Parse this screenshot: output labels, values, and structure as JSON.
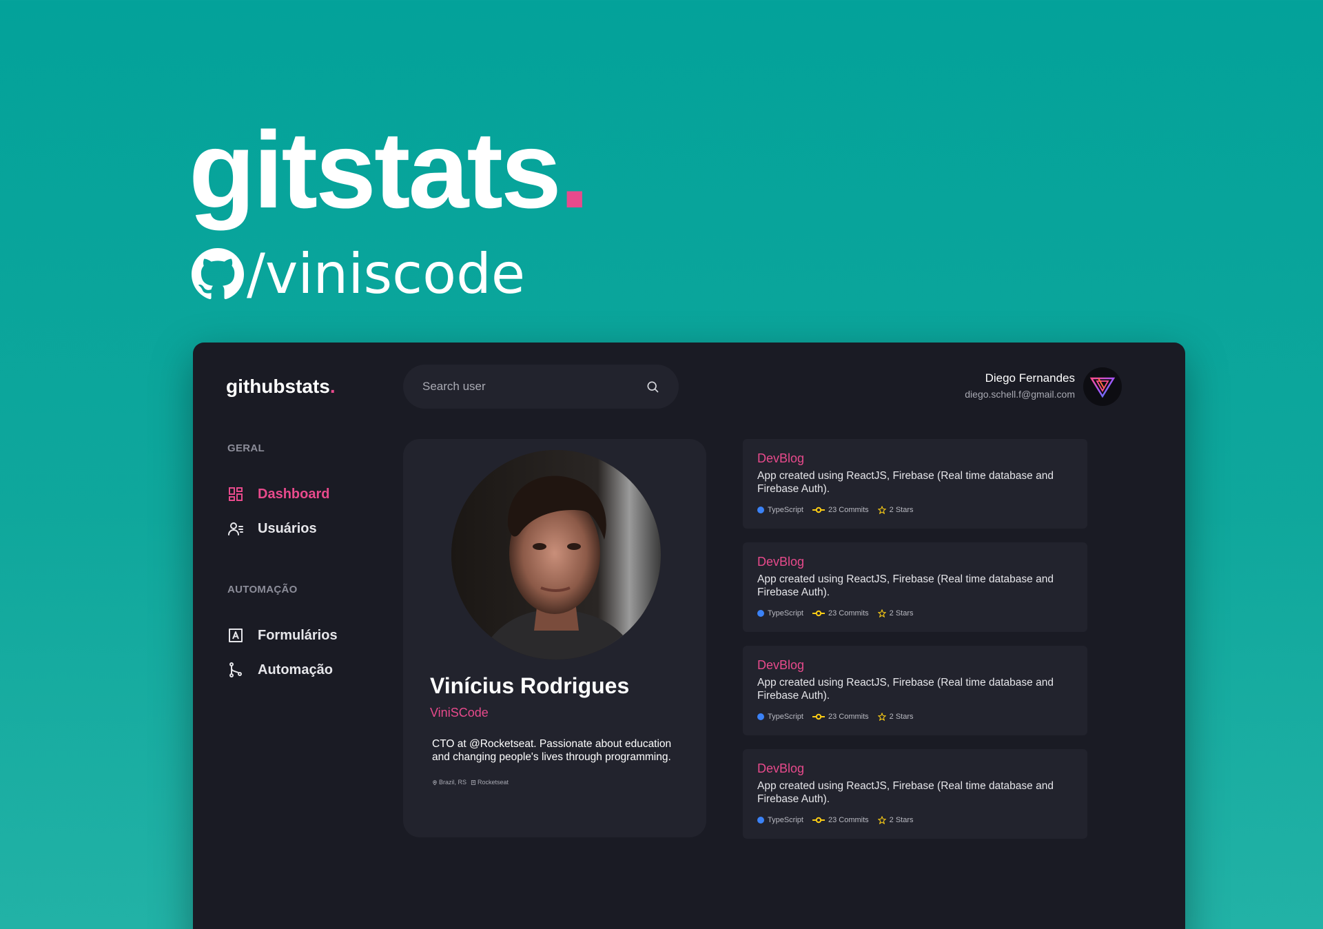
{
  "hero": {
    "title": "gitstats",
    "title_dot": ".",
    "handle": "/viniscode",
    "github_icon": "github-icon"
  },
  "colors": {
    "accent": "#e84a8c",
    "background": "#1a1b24",
    "card": "#22232d",
    "teal": "#0fa79c",
    "language": "#3b82f6",
    "commits": "#facc15",
    "stars": "#facc15"
  },
  "app": {
    "brand": "githubstats",
    "brand_dot": ".",
    "search": {
      "placeholder": "Search user",
      "value": "",
      "icon": "search-icon"
    },
    "user": {
      "name": "Diego Fernandes",
      "email": "diego.schell.f@gmail.com",
      "avatar_icon": "triangle-logo-icon"
    }
  },
  "sidebar": {
    "sections": [
      {
        "title": "GERAL",
        "items": [
          {
            "label": "Dashboard",
            "icon": "dashboard-icon",
            "active": true
          },
          {
            "label": "Usuários",
            "icon": "users-icon",
            "active": false
          }
        ]
      },
      {
        "title": "AUTOMAÇÃO",
        "items": [
          {
            "label": "Formulários",
            "icon": "form-icon",
            "active": false
          },
          {
            "label": "Automação",
            "icon": "git-branch-icon",
            "active": false
          }
        ]
      }
    ]
  },
  "profile": {
    "name": "Vinícius Rodrigues",
    "login": "ViniSCode",
    "bio": "CTO at @Rocketseat. Passionate about education and changing people's lives through programming.",
    "location": "Brazil, RS",
    "company": "Rocketseat"
  },
  "repos": [
    {
      "name": "DevBlog",
      "description": "App created using ReactJS, Firebase (Real time database and Firebase Auth).",
      "language": "TypeScript",
      "commits": "23 Commits",
      "stars": "2 Stars"
    },
    {
      "name": "DevBlog",
      "description": "App created using ReactJS, Firebase (Real time database and Firebase Auth).",
      "language": "TypeScript",
      "commits": "23 Commits",
      "stars": "2 Stars"
    },
    {
      "name": "DevBlog",
      "description": "App created using ReactJS, Firebase (Real time database and Firebase Auth).",
      "language": "TypeScript",
      "commits": "23 Commits",
      "stars": "2 Stars"
    },
    {
      "name": "DevBlog",
      "description": "App created using ReactJS, Firebase (Real time database and Firebase Auth).",
      "language": "TypeScript",
      "commits": "23 Commits",
      "stars": "2 Stars"
    }
  ]
}
